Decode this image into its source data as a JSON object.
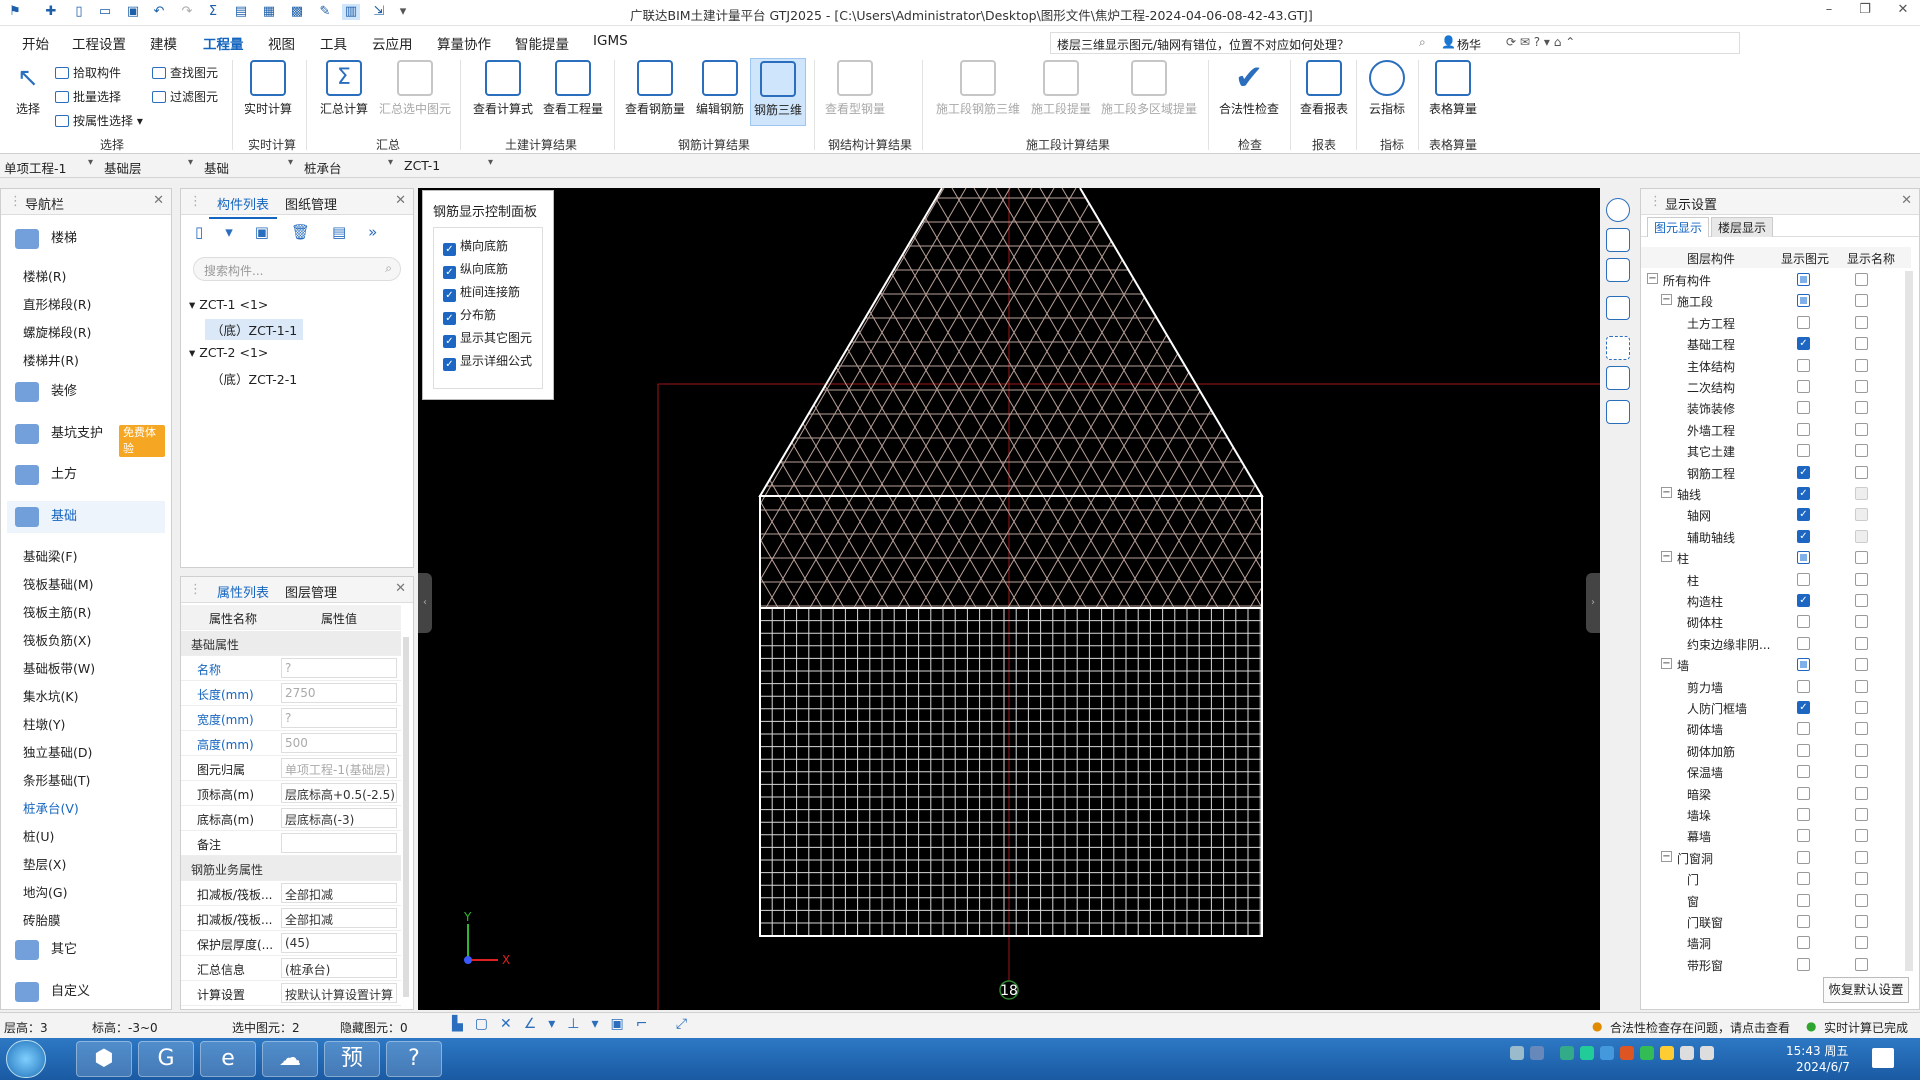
{
  "titlebar": {
    "title": "广联达BIM土建计量平台 GTJ2025 - [C:\\Users\\Administrator\\Desktop\\图形文件\\焦炉工程-2024-04-06-08-42-43.GTJ]"
  },
  "menu": [
    "开始",
    "工程设置",
    "建模",
    "工程量",
    "视图",
    "工具",
    "云应用",
    "算量协作",
    "智能提量",
    "IGMS"
  ],
  "menu_active": "工程量",
  "help": {
    "question": "楼层三维显示图元/轴网有错位，位置不对应如何处理？",
    "user": "杨华"
  },
  "ribbon": {
    "select": [
      "选择",
      "拾取构件",
      "批量选择",
      "按属性选择",
      "查找图元",
      "过滤图元"
    ],
    "buttons": [
      "实时计算",
      "汇总计算",
      "汇总选中图元",
      "查看计算式",
      "查看工程量",
      "查看钢筋量",
      "编辑钢筋",
      "钢筋三维",
      "查看型钢量",
      "施工段钢筋三维",
      "施工段提量",
      "施工段多区域提量",
      "合法性检查",
      "查看报表",
      "云指标",
      "表格算量"
    ],
    "groups": [
      "选择",
      "实时计算",
      "汇总",
      "土建计算结果",
      "钢筋计算结果",
      "钢结构计算结果",
      "施工段计算结果",
      "检查",
      "报表",
      "指标",
      "表格算量"
    ]
  },
  "selectors": [
    "单项工程-1",
    "基础层",
    "基础",
    "桩承台",
    "ZCT-1"
  ],
  "nav": {
    "title": "导航栏",
    "cats": [
      "楼梯",
      "装修",
      "基坑支护",
      "土方",
      "基础",
      "其它",
      "自定义"
    ],
    "free": "免费体验",
    "stairs": [
      "楼梯(R)",
      "直形梯段(R)",
      "螺旋梯段(R)",
      "楼梯井(R)"
    ],
    "found": [
      "基础梁(F)",
      "筏板基础(M)",
      "筏板主筋(R)",
      "筏板负筋(X)",
      "基础板带(W)",
      "集水坑(K)",
      "柱墩(Y)",
      "独立基础(D)",
      "条形基础(T)",
      "桩承台(V)",
      "桩(U)",
      "垫层(X)",
      "地沟(G)",
      "砖胎膜"
    ]
  },
  "comp": {
    "tabs": [
      "构件列表",
      "图纸管理"
    ],
    "search": "搜索构件...",
    "tree": [
      "ZCT-1 <1>",
      "（底）ZCT-1-1",
      "ZCT-2 <1>",
      "（底）ZCT-2-1"
    ]
  },
  "props": {
    "tabs": [
      "属性列表",
      "图层管理"
    ],
    "header": [
      "属性名称",
      "属性值"
    ],
    "rows": [
      [
        "基础属性",
        ""
      ],
      [
        "名称",
        "?"
      ],
      [
        "长度(mm)",
        "2750"
      ],
      [
        "宽度(mm)",
        "?"
      ],
      [
        "高度(mm)",
        "500"
      ],
      [
        "图元归属",
        "单项工程-1(基础层)"
      ],
      [
        "顶标高(m)",
        "层底标高+0.5(-2.5)"
      ],
      [
        "底标高(m)",
        "层底标高(-3)"
      ],
      [
        "备注",
        ""
      ],
      [
        "钢筋业务属性",
        ""
      ],
      [
        "扣减板/筏板...",
        "全部扣减"
      ],
      [
        "扣减板/筏板...",
        "全部扣减"
      ],
      [
        "保护层厚度(...",
        "(45)"
      ],
      [
        "汇总信息",
        "(桩承台)"
      ],
      [
        "计算设置",
        "按默认计算设置计算"
      ]
    ]
  },
  "rebar_panel": {
    "title": "钢筋显示控制面板",
    "items": [
      "横向底筋",
      "纵向底筋",
      "桩间连接筋",
      "分布筋",
      "显示其它图元",
      "显示详细公式"
    ]
  },
  "viewport": {
    "axis_label": "18",
    "axis_x": "X",
    "axis_y": "Y"
  },
  "display": {
    "title": "显示设置",
    "tabs": [
      "图元显示",
      "楼层显示"
    ],
    "cols": [
      "图层构件",
      "显示图元",
      "显示名称"
    ],
    "rows": [
      [
        "所有构件",
        "part",
        "off",
        0,
        "-"
      ],
      [
        "施工段",
        "part",
        "off",
        1,
        "-"
      ],
      [
        "土方工程",
        "off",
        "off",
        2,
        ""
      ],
      [
        "基础工程",
        "on",
        "off",
        2,
        ""
      ],
      [
        "主体结构",
        "off",
        "off",
        2,
        ""
      ],
      [
        "二次结构",
        "off",
        "off",
        2,
        ""
      ],
      [
        "装饰装修",
        "off",
        "off",
        2,
        ""
      ],
      [
        "外墙工程",
        "off",
        "off",
        2,
        ""
      ],
      [
        "其它土建",
        "off",
        "off",
        2,
        ""
      ],
      [
        "钢筋工程",
        "on",
        "off",
        2,
        ""
      ],
      [
        "轴线",
        "on",
        "dis",
        1,
        "-"
      ],
      [
        "轴网",
        "on",
        "dis",
        2,
        ""
      ],
      [
        "辅助轴线",
        "on",
        "dis",
        2,
        ""
      ],
      [
        "柱",
        "part",
        "off",
        1,
        "-"
      ],
      [
        "柱",
        "off",
        "off",
        2,
        ""
      ],
      [
        "构造柱",
        "on",
        "off",
        2,
        ""
      ],
      [
        "砌体柱",
        "off",
        "off",
        2,
        ""
      ],
      [
        "约束边缘非阴...",
        "off",
        "off",
        2,
        ""
      ],
      [
        "墙",
        "part",
        "off",
        1,
        "-"
      ],
      [
        "剪力墙",
        "off",
        "off",
        2,
        ""
      ],
      [
        "人防门框墙",
        "on",
        "off",
        2,
        ""
      ],
      [
        "砌体墙",
        "off",
        "off",
        2,
        ""
      ],
      [
        "砌体加筋",
        "off",
        "off",
        2,
        ""
      ],
      [
        "保温墙",
        "off",
        "off",
        2,
        ""
      ],
      [
        "暗梁",
        "off",
        "off",
        2,
        ""
      ],
      [
        "墙垛",
        "off",
        "off",
        2,
        ""
      ],
      [
        "幕墙",
        "off",
        "off",
        2,
        ""
      ],
      [
        "门窗洞",
        "off",
        "off",
        1,
        "-"
      ],
      [
        "门",
        "off",
        "off",
        2,
        ""
      ],
      [
        "窗",
        "off",
        "off",
        2,
        ""
      ],
      [
        "门联窗",
        "off",
        "off",
        2,
        ""
      ],
      [
        "墙洞",
        "off",
        "off",
        2,
        ""
      ],
      [
        "带形窗",
        "off",
        "off",
        2,
        ""
      ]
    ],
    "restore": "恢复默认设置"
  },
  "status": {
    "floor": "层高：3",
    "elev": "标高：-3~0",
    "selected": "选中图元：2",
    "hidden": "隐藏图元：0",
    "legal": "合法性检查存在问题，请点击查看",
    "realtime": "实时计算已完成"
  },
  "taskbar": {
    "time": "15:43 周五",
    "date": "2024/6/7"
  }
}
